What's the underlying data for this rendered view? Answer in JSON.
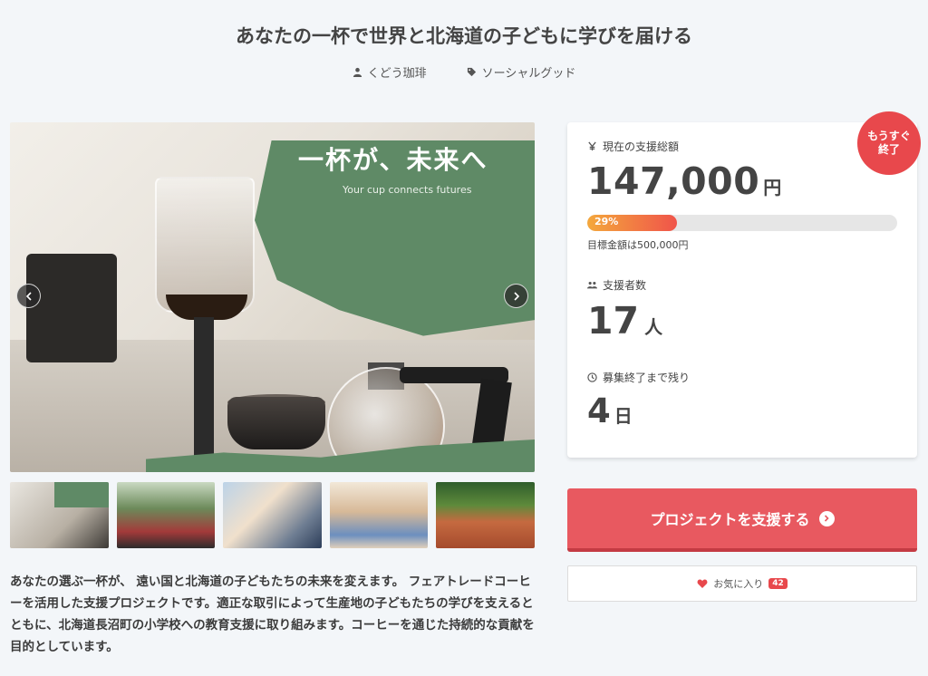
{
  "project": {
    "title": "あなたの一杯で世界と北海道の子どもに学びを届ける",
    "owner": "くどう珈琲",
    "category": "ソーシャルグッド"
  },
  "hero": {
    "banner_title": "一杯が、未来へ",
    "banner_subtitle": "Your cup connects futures"
  },
  "description": "あなたの選ぶ一杯が、 遠い国と北海道の子どもたちの未来を変えます。 フェアトレードコーヒーを活用した支援プロジェクトです。適正な取引によって生産地の子どもたちの学びを支えるとともに、北海道長沼町の小学校への教育支援に取り組みます。コーヒーを通じた持続的な貢献を目的としています。",
  "stats": {
    "badge": "もうすぐ\n終了",
    "badge_line1": "もうすぐ",
    "badge_line2": "終了",
    "funding_label": "現在の支援総額",
    "funding_amount": "147,000",
    "funding_unit": "円",
    "progress_percent": 29,
    "progress_label": "29%",
    "goal_text": "目標金額は500,000円",
    "supporters_label": "支援者数",
    "supporters_count": "17",
    "supporters_unit": "人",
    "remaining_label": "募集終了まで残り",
    "remaining_days": "4",
    "remaining_unit": "日"
  },
  "actions": {
    "support_label": "プロジェクトを支援する",
    "favorite_label": "お気に入り",
    "favorite_count": "42"
  },
  "colors": {
    "accent": "#e85960",
    "badge": "#e8484c",
    "banner_green": "#5f8a66"
  }
}
